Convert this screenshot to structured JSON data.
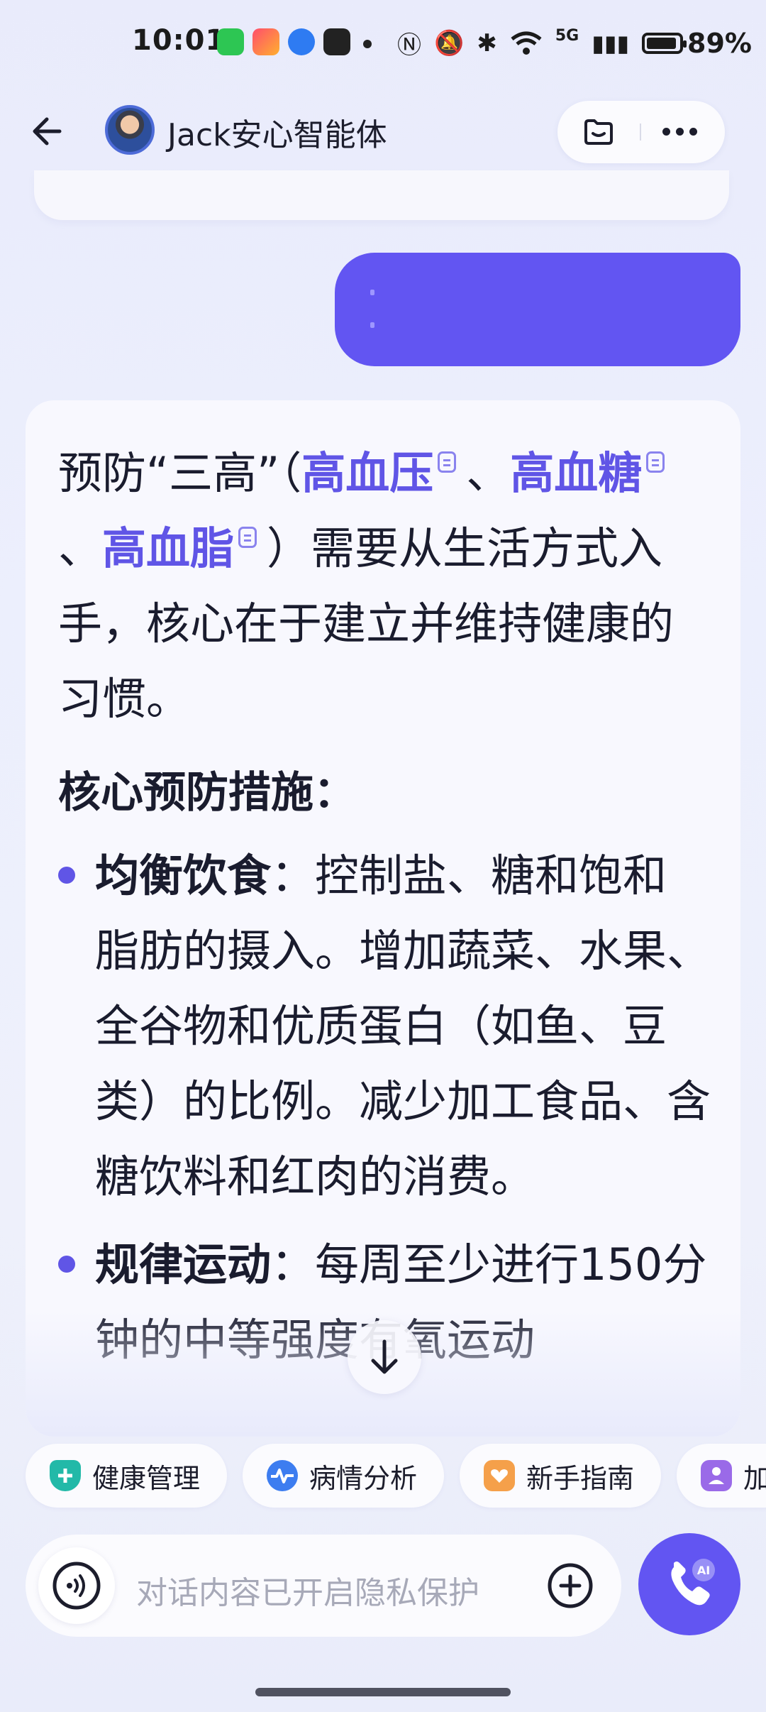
{
  "status_bar": {
    "time": "10:01",
    "network": "5G",
    "battery": "89%"
  },
  "header": {
    "title": "Jack安心智能体"
  },
  "answer": {
    "intro_parts": [
      "预防“三高”（",
      "高血压",
      "、",
      "高血糖",
      "、",
      "高血脂",
      "）需要从生活方式入手，核心在于建立并维持健康的习惯。"
    ],
    "heading": "核心预防措施：",
    "bullets": [
      {
        "title": "均衡饮食",
        "text": "：控制盐、糖和饱和脂肪的摄入。增加蔬菜、水果、全谷物和优质蛋白（如鱼、豆类）的比例。减少加工食品、含糖饮料和红肉的消费。"
      },
      {
        "title": "规律运动",
        "text": "：每周至少进行150分钟的中等强度有氧运动"
      }
    ]
  },
  "chips": [
    {
      "label": "健康管理",
      "icon": "health-shield-icon",
      "color": "#22b9a8"
    },
    {
      "label": "病情分析",
      "icon": "pulse-icon",
      "color": "#3d7df0"
    },
    {
      "label": "新手指南",
      "icon": "heart-hand-icon",
      "color": "#f5a04a"
    },
    {
      "label": "加",
      "icon": "person-icon",
      "color": "#9a6ae8"
    }
  ],
  "input": {
    "placeholder": "对话内容已开启隐私保护"
  },
  "call_button": {
    "badge": "AI"
  },
  "colors": {
    "accent": "#6255f2",
    "link": "#6055e6"
  }
}
